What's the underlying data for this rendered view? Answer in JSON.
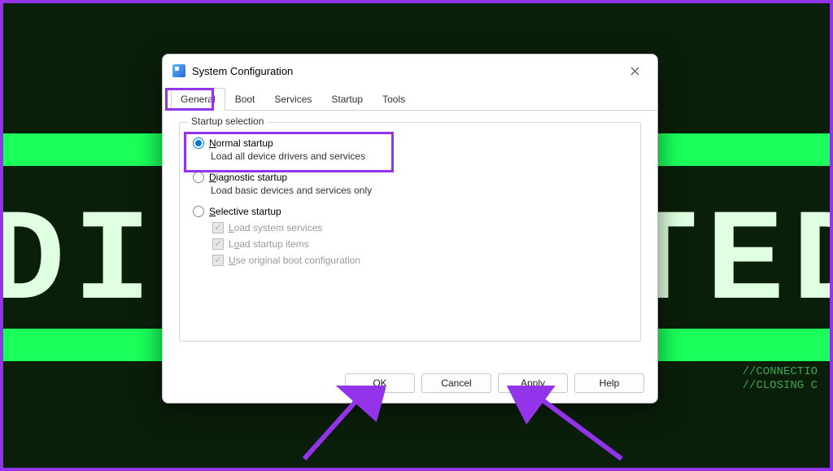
{
  "window": {
    "title": "System Configuration"
  },
  "tabs": {
    "general": "General",
    "boot": "Boot",
    "services": "Services",
    "startup": "Startup",
    "tools": "Tools",
    "active": "general"
  },
  "group": {
    "title": "Startup selection",
    "normal": {
      "label": "Normal startup",
      "desc": "Load all device drivers and services",
      "checked": true
    },
    "diagnostic": {
      "label": "Diagnostic startup",
      "desc": "Load basic devices and services only",
      "checked": false
    },
    "selective": {
      "label": "Selective startup",
      "checked": false,
      "load_system": "Load system services",
      "load_startup": "Load startup items",
      "use_original": "Use original boot configuration"
    }
  },
  "buttons": {
    "ok": "OK",
    "cancel": "Cancel",
    "apply": "Apply",
    "help": "Help"
  },
  "background": {
    "big_text_left": "DIS",
    "big_text_right": "TED",
    "small1": "//CONNECTIO",
    "small2": "//CLOSING C"
  },
  "colors": {
    "highlight": "#9333ea",
    "accent": "#0078d4"
  }
}
